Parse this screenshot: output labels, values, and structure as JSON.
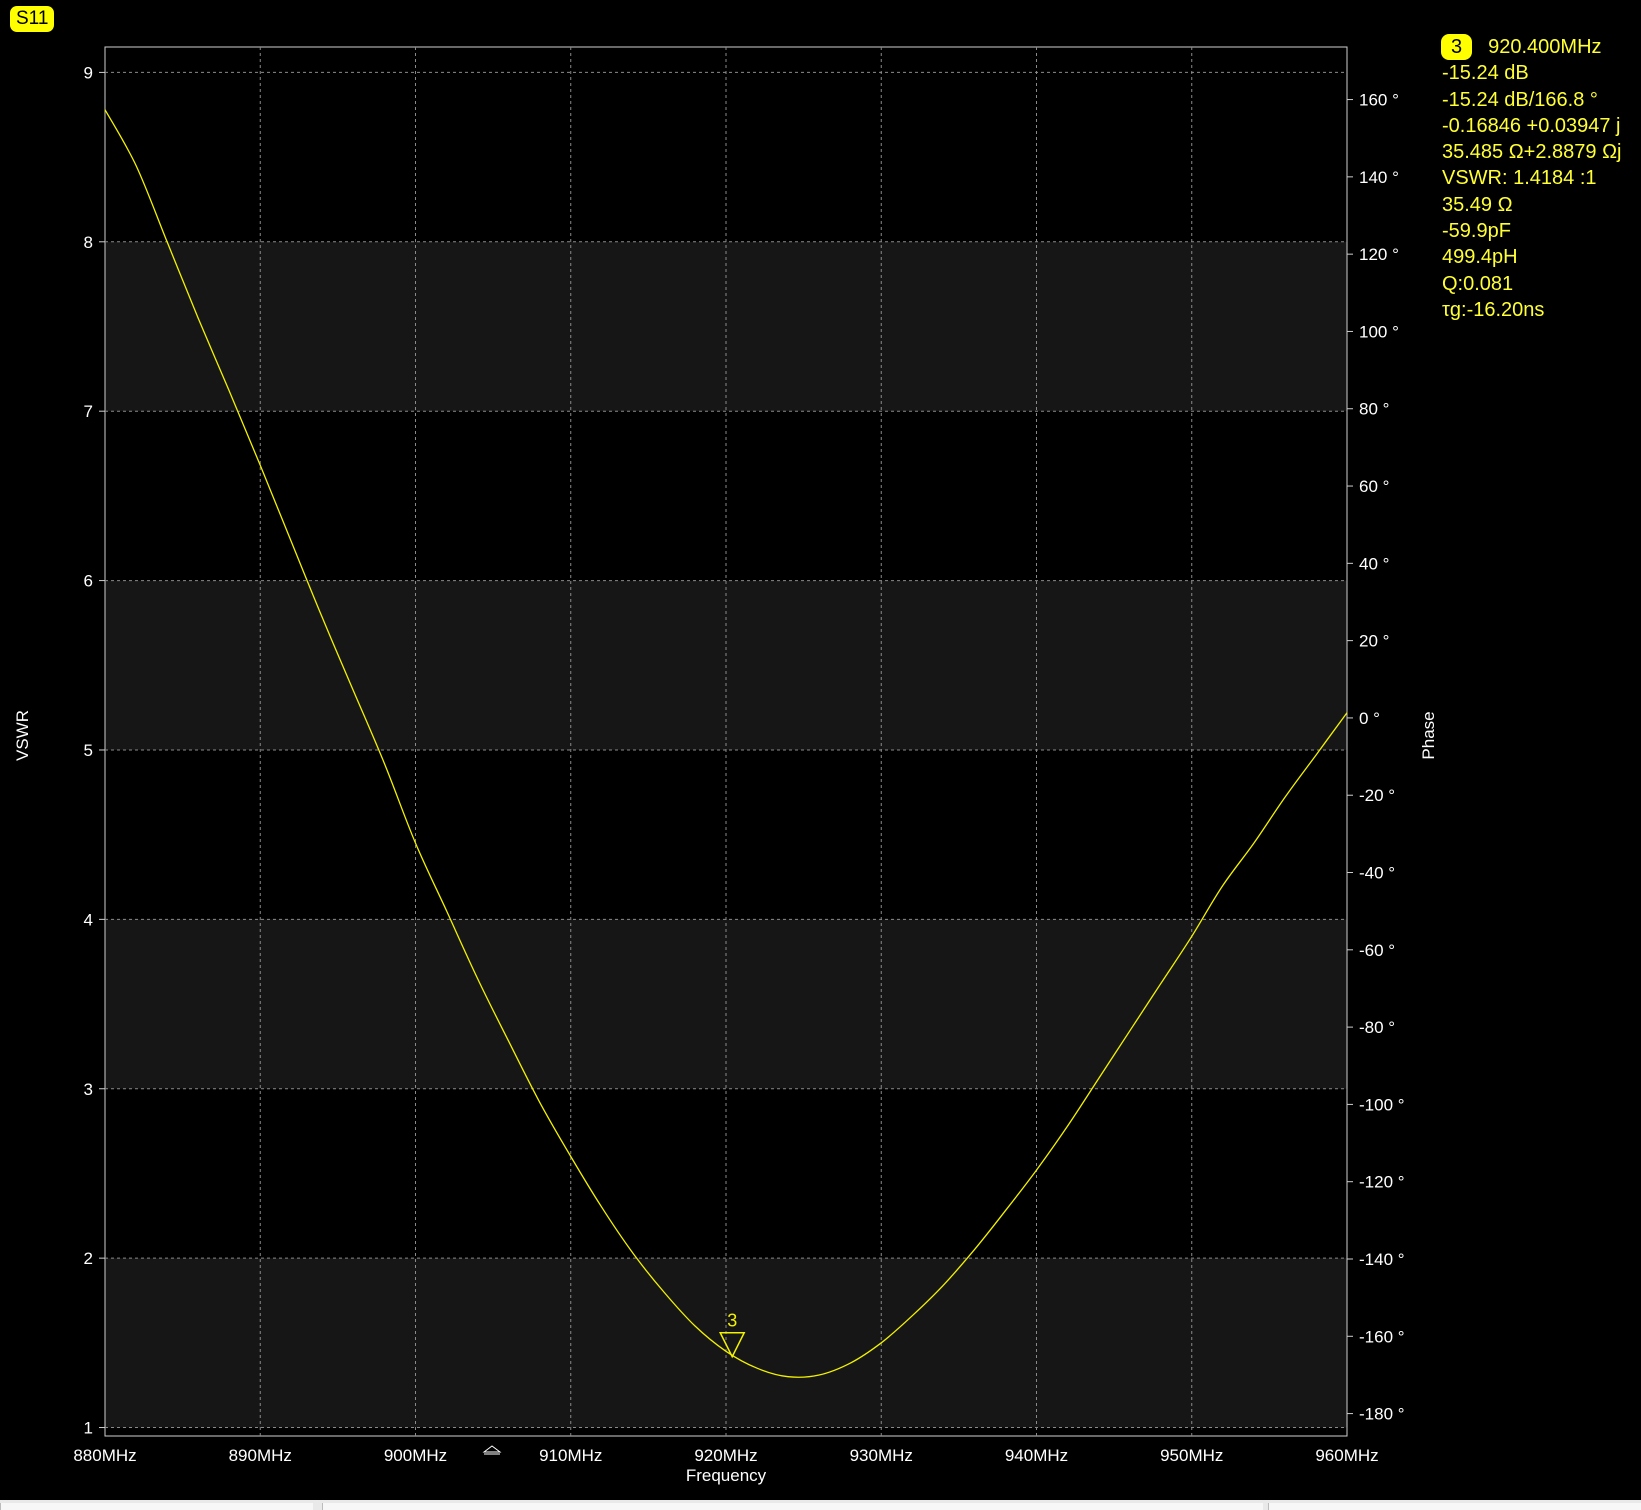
{
  "trace_label": "S11",
  "marker_readout": {
    "marker": "3",
    "frequency": "920.400MHz",
    "lines": [
      "-15.24 dB",
      "-15.24 dB/166.8 °",
      "-0.16846 +0.03947 j",
      "35.485 Ω+2.8879 Ωj",
      "VSWR: 1.4184 :1",
      "35.49 Ω",
      "-59.9pF",
      "499.4pH",
      "Q:0.081",
      "τg:-16.20ns"
    ]
  },
  "colors": {
    "background": "#000000",
    "band": "#161616",
    "grid": "#8a8a8a",
    "trace": "#f2f200",
    "marker": "#f2f200",
    "axis_text": "#ffffff"
  },
  "chart_data": {
    "type": "line",
    "xlabel": "Frequency",
    "ylabel": "VSWR",
    "y2label": "Phase",
    "xlim": [
      880,
      960
    ],
    "ylim": [
      0.95,
      9.15
    ],
    "y2lim": [
      -185.8,
      173.6
    ],
    "x_ticks": [
      880,
      890,
      900,
      910,
      920,
      930,
      940,
      950,
      960
    ],
    "x_tick_labels": [
      "880MHz",
      "890MHz",
      "900MHz",
      "910MHz",
      "920MHz",
      "930MHz",
      "940MHz",
      "950MHz",
      "960MHz"
    ],
    "y_ticks": [
      1,
      2,
      3,
      4,
      5,
      6,
      7,
      8,
      9
    ],
    "y_tick_labels": [
      "1",
      "2",
      "3",
      "4",
      "5",
      "6",
      "7",
      "8",
      "9"
    ],
    "y2_ticks": [
      160,
      140,
      120,
      100,
      80,
      60,
      40,
      20,
      0,
      -20,
      -40,
      -60,
      -80,
      -100,
      -120,
      -140,
      -160,
      -180
    ],
    "y2_tick_labels": [
      "160 °",
      "140 °",
      "120 °",
      "100 °",
      "80 °",
      "60 °",
      "40 °",
      "20 °",
      "0 °",
      "-20 °",
      "-40 °",
      "-60 °",
      "-80 °",
      "-100 °",
      "-120 °",
      "-140 °",
      "-160 °",
      "-180 °"
    ],
    "grid": true,
    "series": [
      {
        "x": [
          880,
          882,
          884,
          886,
          888,
          890,
          892,
          894,
          896,
          898,
          900,
          902,
          904,
          906,
          908,
          910,
          912,
          914,
          916,
          918,
          920,
          922,
          924,
          926,
          928,
          930,
          932,
          934,
          936,
          938,
          940,
          942,
          944,
          946,
          948,
          950,
          952,
          954,
          956,
          958,
          960
        ],
        "values": [
          8.78,
          8.45,
          8.0,
          7.55,
          7.12,
          6.68,
          6.23,
          5.78,
          5.35,
          4.92,
          4.45,
          4.05,
          3.65,
          3.28,
          2.92,
          2.6,
          2.3,
          2.03,
          1.8,
          1.6,
          1.45,
          1.35,
          1.3,
          1.31,
          1.38,
          1.5,
          1.66,
          1.84,
          2.05,
          2.28,
          2.52,
          2.78,
          3.06,
          3.34,
          3.62,
          3.9,
          4.2,
          4.45,
          4.72,
          4.97,
          5.22
        ]
      }
    ],
    "markers": [
      {
        "label": "3",
        "x": 920.4,
        "y": 1.418
      }
    ]
  }
}
